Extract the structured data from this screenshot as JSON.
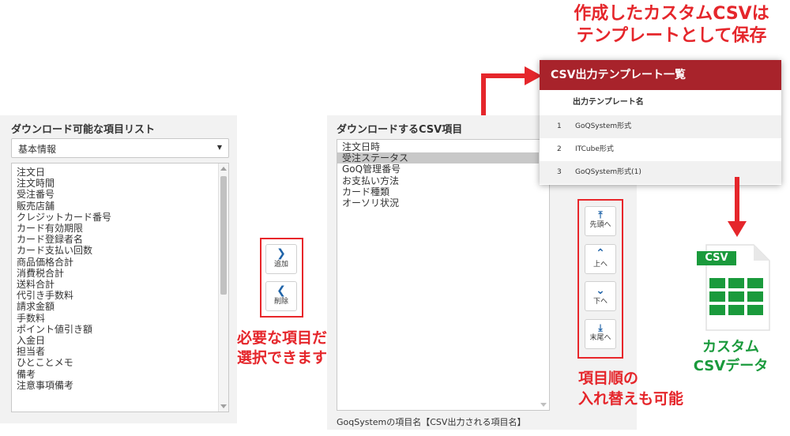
{
  "callouts": {
    "template_save_line1": "作成したカスタムCSVは",
    "template_save_line2": "テンプレートとして保存",
    "select_line1": "必要な項目だけを",
    "select_line2": "選択できます",
    "reorder_line1": "項目順の",
    "reorder_line2": "入れ替えも可能",
    "csv_line1": "カスタム",
    "csv_line2": "CSVデータ",
    "csv_badge": "CSV"
  },
  "available": {
    "title": "ダウンロード可能な項目リスト",
    "category_selected": "基本情報",
    "items": [
      "注文日",
      "注文時間",
      "受注番号",
      "販売店舗",
      "クレジットカード番号",
      "カード有効期限",
      "カード登録者名",
      "カード支払い回数",
      "商品価格合計",
      "消費税合計",
      "送料合計",
      "代引き手数料",
      "請求金額",
      "手数料",
      "ポイント値引き額",
      "入金日",
      "担当者",
      "ひとことメモ",
      "備考",
      "注意事項備考"
    ]
  },
  "transfer": {
    "add_label": "追加",
    "remove_label": "削除"
  },
  "download": {
    "title": "ダウンロードするCSV項目",
    "items": [
      "注文日時",
      "受注ステータス",
      "GoQ管理番号",
      "お支払い方法",
      "カード種類",
      "オーソリ状況"
    ],
    "selected_index": 1,
    "footer_note": "GoqSystemの項目名【CSV出力される項目名】"
  },
  "order": {
    "top_label": "先頭へ",
    "up_label": "上へ",
    "down_label": "下へ",
    "bottom_label": "末尾へ"
  },
  "templates": {
    "header": "CSV出力テンプレート一覧",
    "column_label": "出力テンプレート名",
    "rows": [
      {
        "num": "1",
        "name": "GoQSystem形式"
      },
      {
        "num": "2",
        "name": "ITCube形式"
      },
      {
        "num": "3",
        "name": "GoQSystem形式(1)"
      }
    ]
  },
  "colors": {
    "accent_red": "#e5262b",
    "header_red": "#a8232b",
    "csv_green": "#1a9a3c",
    "button_blue": "#1f63a8"
  }
}
